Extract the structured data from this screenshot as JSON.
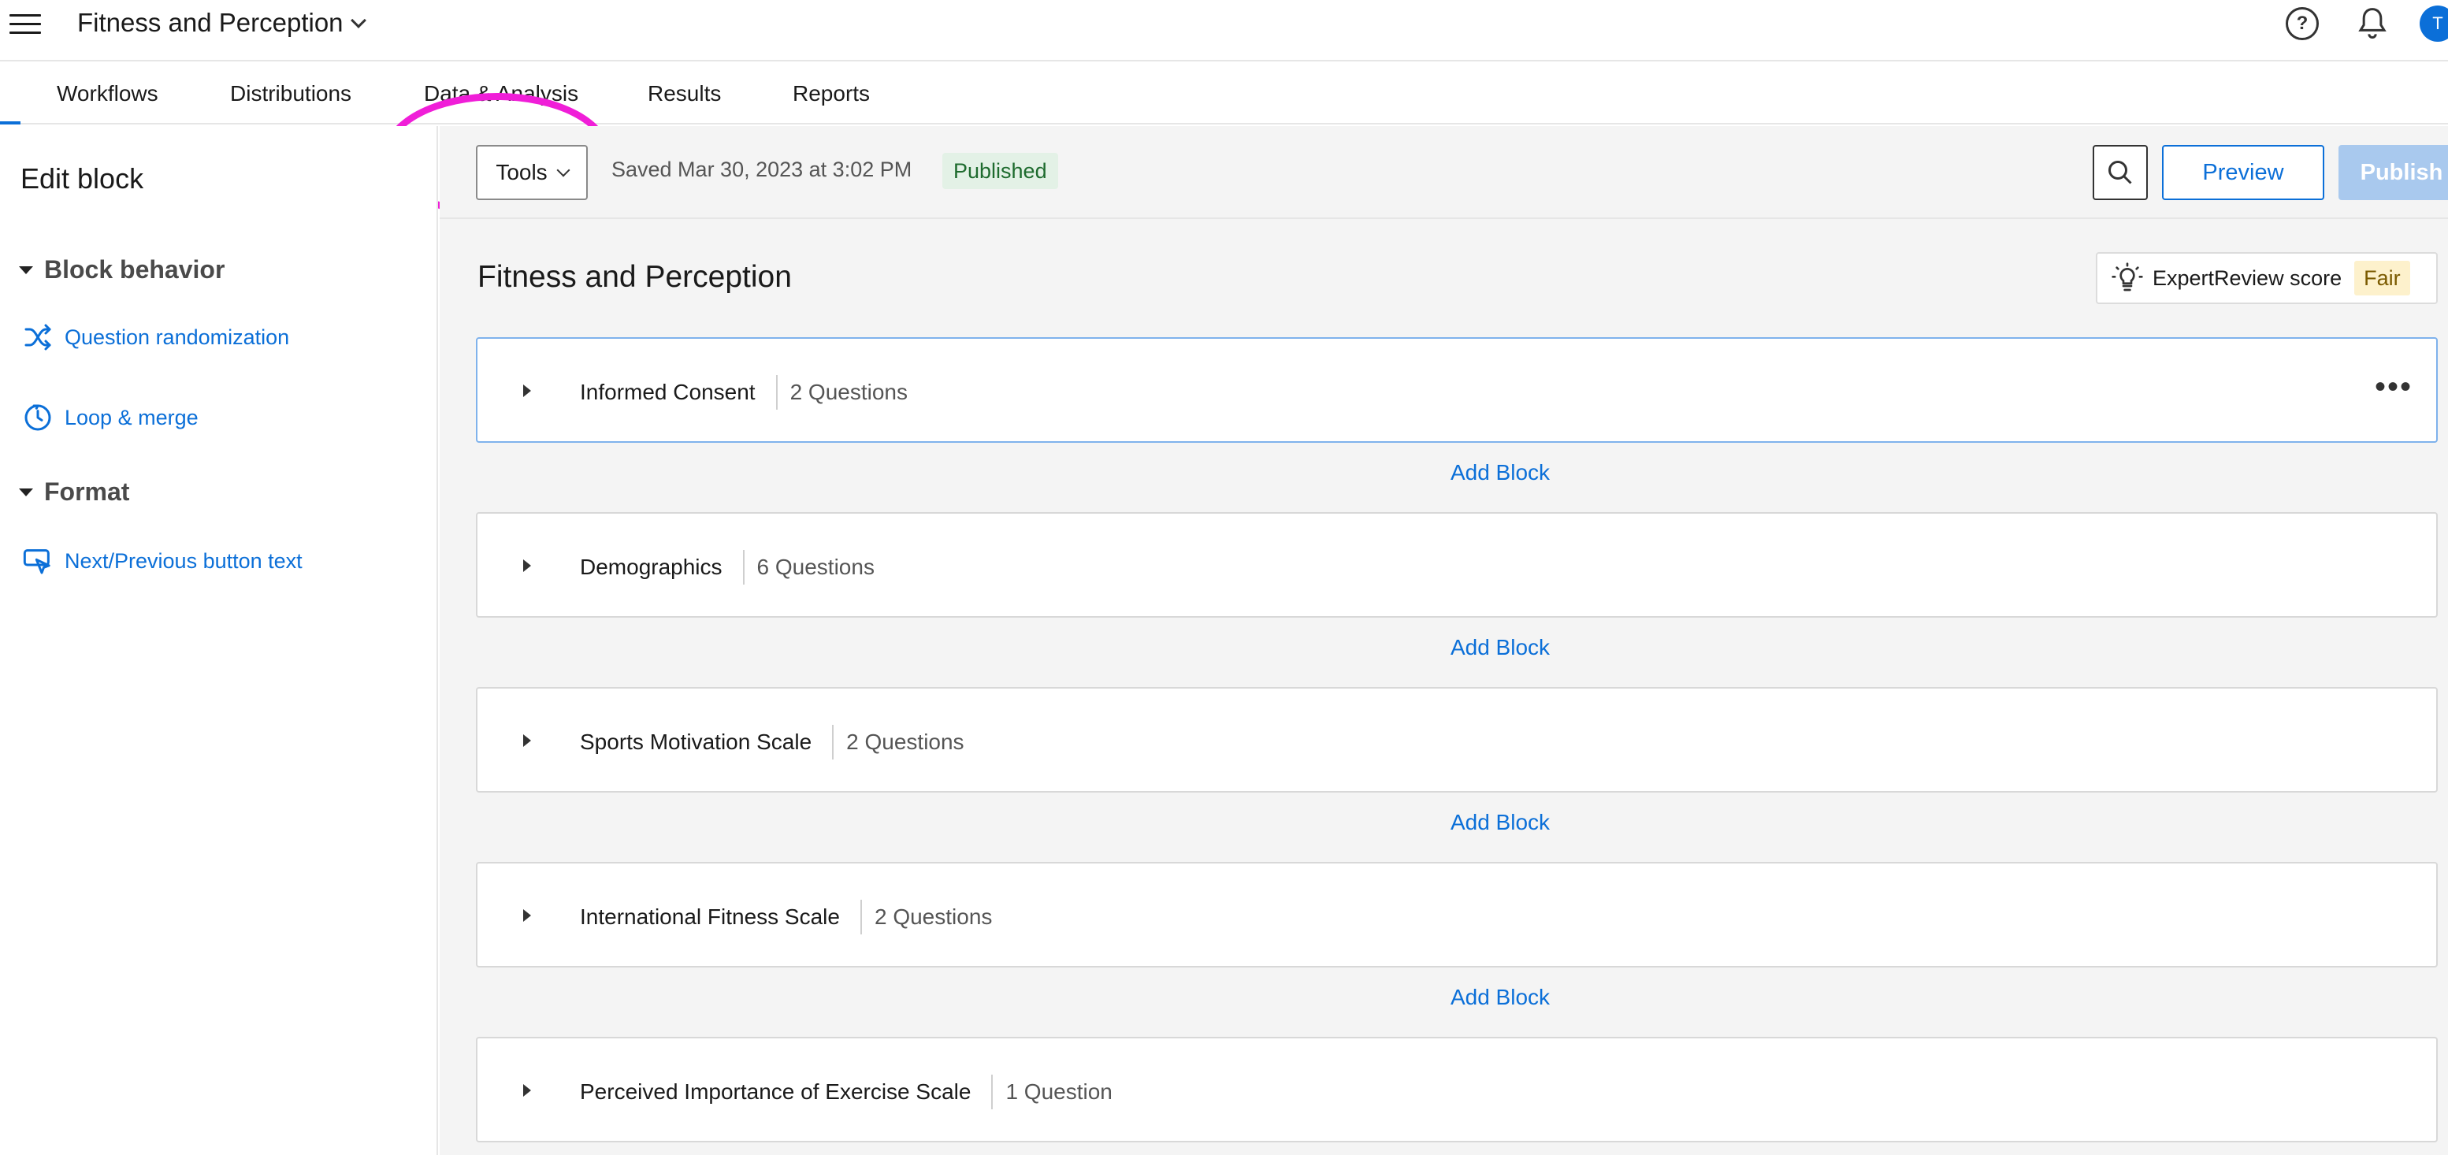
{
  "topbar": {
    "project_title": "Fitness and Perception",
    "help_symbol": "?",
    "avatar_initial": "T"
  },
  "nav": {
    "tabs": [
      {
        "label": "Workflows"
      },
      {
        "label": "Distributions"
      },
      {
        "label": "Data & Analysis"
      },
      {
        "label": "Results"
      },
      {
        "label": "Reports"
      }
    ],
    "highlight_color": "#f01ed8"
  },
  "sidebar": {
    "title": "Edit block",
    "sections": [
      {
        "header": "Block behavior",
        "items": [
          {
            "label": "Question randomization",
            "icon": "shuffle-icon"
          },
          {
            "label": "Loop & merge",
            "icon": "loop-icon"
          }
        ]
      },
      {
        "header": "Format",
        "items": [
          {
            "label": "Next/Previous button text",
            "icon": "cursor-click-icon"
          }
        ]
      }
    ]
  },
  "toolbar": {
    "tools_label": "Tools",
    "saved_text": "Saved Mar 30, 2023 at 3:02 PM",
    "status_badge": "Published",
    "preview_label": "Preview",
    "publish_label": "Publish"
  },
  "survey": {
    "title": "Fitness and Perception",
    "expert_review_label": "ExpertReview score",
    "expert_review_score": "Fair",
    "add_block_label": "Add Block",
    "blocks": [
      {
        "name": "Informed Consent",
        "count": "2 Questions"
      },
      {
        "name": "Demographics",
        "count": "6 Questions"
      },
      {
        "name": "Sports Motivation Scale",
        "count": "2 Questions"
      },
      {
        "name": "International Fitness Scale",
        "count": "2 Questions"
      },
      {
        "name": "Perceived Importance of Exercise Scale",
        "count": "1 Question"
      }
    ]
  },
  "colors": {
    "accent": "#0b6fd8",
    "published_bg": "#e3f1e6",
    "fair_bg": "#fdf1cc"
  }
}
